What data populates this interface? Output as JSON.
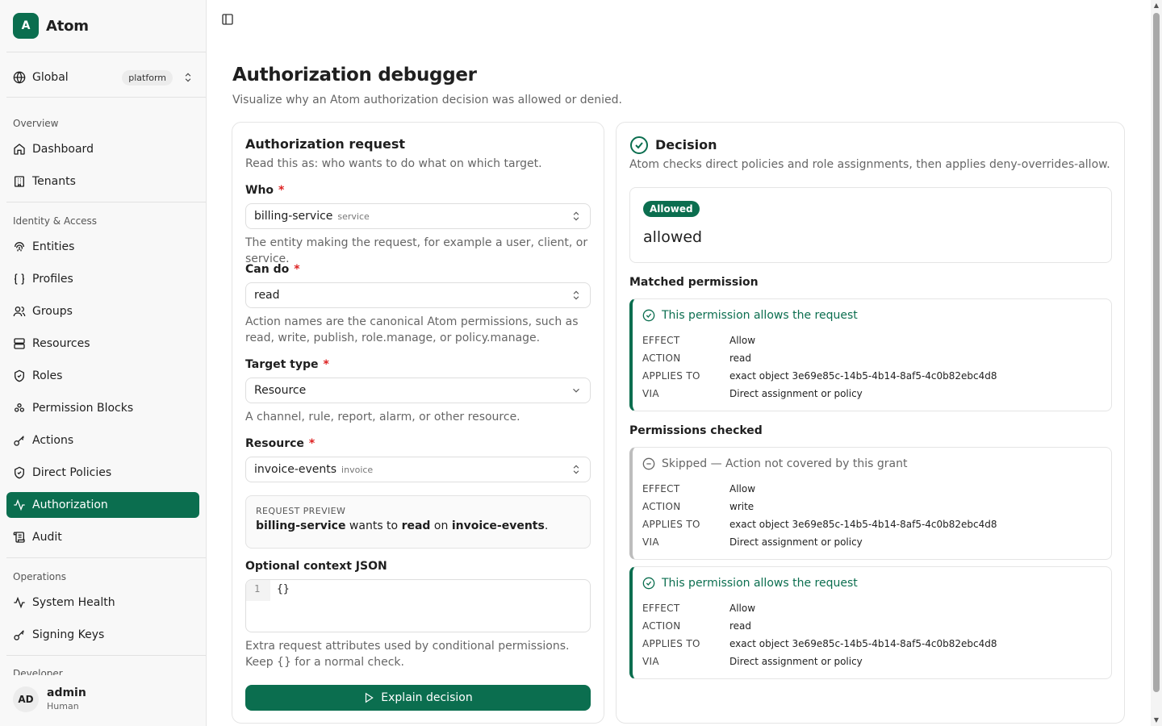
{
  "brand": {
    "logo_letter": "A",
    "name": "Atom"
  },
  "scope": {
    "label": "Global",
    "badge": "platform"
  },
  "groups": {
    "overview": "Overview",
    "identity": "Identity & Access",
    "operations": "Operations",
    "developer": "Developer"
  },
  "nav": {
    "dashboard": "Dashboard",
    "tenants": "Tenants",
    "entities": "Entities",
    "profiles": "Profiles",
    "groups": "Groups",
    "resources": "Resources",
    "roles": "Roles",
    "permission_blocks": "Permission Blocks",
    "actions": "Actions",
    "direct_policies": "Direct Policies",
    "authorization": "Authorization",
    "audit": "Audit",
    "system_health": "System Health",
    "signing_keys": "Signing Keys"
  },
  "user": {
    "initials": "AD",
    "name": "admin",
    "role": "Human"
  },
  "page": {
    "title": "Authorization debugger",
    "subtitle": "Visualize why an Atom authorization decision was allowed or denied."
  },
  "request": {
    "title": "Authorization request",
    "subtitle": "Read this as: who wants to do what on which target.",
    "who_label": "Who",
    "who_value": "billing-service",
    "who_sub": "service",
    "who_help": "The entity making the request, for example a user, client, or service.",
    "cando_label": "Can do",
    "cando_value": "read",
    "cando_help": "Action names are the canonical Atom permissions, such as read, write, publish, role.manage, or policy.manage.",
    "target_label": "Target type",
    "target_value": "Resource",
    "target_help": "A channel, rule, report, alarm, or other resource.",
    "resource_label": "Resource",
    "resource_value": "invoice-events",
    "resource_sub": "invoice",
    "required_mark": "*",
    "preview_label": "REQUEST PREVIEW",
    "preview_who": "billing-service",
    "preview_wants": "wants to",
    "preview_action": "read",
    "preview_on": "on",
    "preview_target": "invoice-events",
    "preview_end": ".",
    "context_label": "Optional context JSON",
    "context_line": "1",
    "context_value": "{}",
    "context_help": "Extra request attributes used by conditional permissions. Keep {} for a normal check.",
    "button": "Explain decision"
  },
  "decision": {
    "title": "Decision",
    "subtitle": "Atom checks direct policies and role assignments, then applies deny-overrides-allow.",
    "badge": "Allowed",
    "result": "allowed",
    "matched_label": "Matched permission",
    "checked_label": "Permissions checked",
    "keys": {
      "effect": "EFFECT",
      "action": "ACTION",
      "applies": "APPLIES TO",
      "via": "VIA"
    },
    "matched": {
      "head": "This permission allows the request",
      "effect": "Allow",
      "action": "read",
      "applies": "exact object 3e69e85c-14b5-4b14-8af5-4c0b82ebc4d8",
      "via": "Direct assignment or policy"
    },
    "checked": [
      {
        "head": "Skipped — Action not covered by this grant",
        "effect": "Allow",
        "action": "write",
        "applies": "exact object 3e69e85c-14b5-4b14-8af5-4c0b82ebc4d8",
        "via": "Direct assignment or policy"
      },
      {
        "head": "This permission allows the request",
        "effect": "Allow",
        "action": "read",
        "applies": "exact object 3e69e85c-14b5-4b14-8af5-4c0b82ebc4d8",
        "via": "Direct assignment or policy"
      }
    ]
  },
  "colors": {
    "accent": "#0b6e4f",
    "required": "#dd2222"
  }
}
